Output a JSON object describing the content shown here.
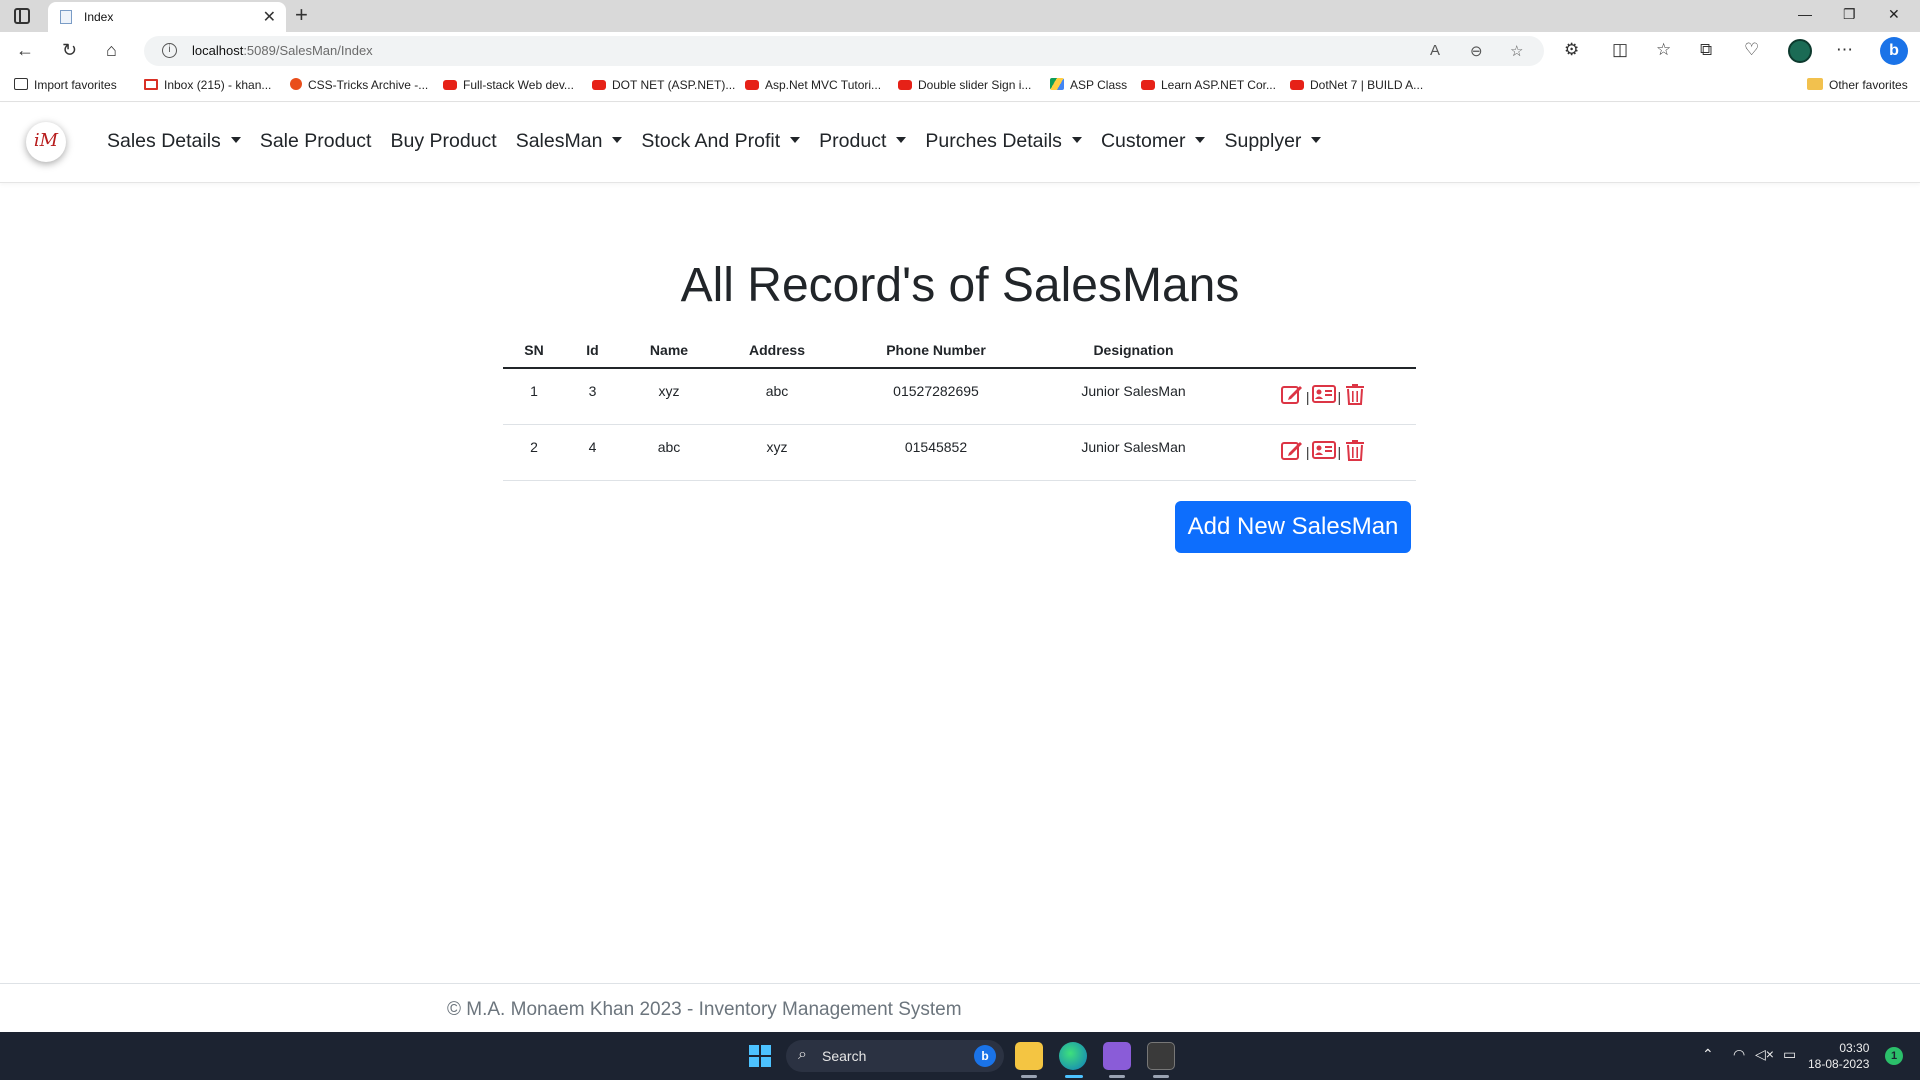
{
  "browser": {
    "tab_title": "Index",
    "tab_close": "✕",
    "new_tab": "+",
    "url_host": "localhost",
    "url_path": ":5089/SalesMan/Index",
    "favorites": [
      {
        "label": "Import favorites",
        "icon": "import-icon"
      },
      {
        "label": "Inbox (215) - khan...",
        "icon": "gmail-icon"
      },
      {
        "label": "CSS-Tricks Archive -...",
        "icon": "css-tricks-icon"
      },
      {
        "label": "Full-stack Web dev...",
        "icon": "youtube-icon"
      },
      {
        "label": "DOT NET (ASP.NET)...",
        "icon": "youtube-icon"
      },
      {
        "label": "Asp.Net MVC Tutori...",
        "icon": "youtube-icon"
      },
      {
        "label": "Double slider Sign i...",
        "icon": "youtube-icon"
      },
      {
        "label": "ASP Class",
        "icon": "drive-icon"
      },
      {
        "label": "Learn ASP.NET Cor...",
        "icon": "youtube-icon"
      },
      {
        "label": "DotNet 7 | BUILD A...",
        "icon": "youtube-icon"
      }
    ],
    "other_favorites": "Other favorites"
  },
  "site": {
    "logo_text": "iM",
    "menu": [
      {
        "label": "Sales Details",
        "dropdown": true
      },
      {
        "label": "Sale Product",
        "dropdown": false
      },
      {
        "label": "Buy Product",
        "dropdown": false
      },
      {
        "label": "SalesMan",
        "dropdown": true
      },
      {
        "label": "Stock And Profit",
        "dropdown": true
      },
      {
        "label": "Product",
        "dropdown": true
      },
      {
        "label": "Purches Details",
        "dropdown": true
      },
      {
        "label": "Customer",
        "dropdown": true
      },
      {
        "label": "Supplyer",
        "dropdown": true
      }
    ]
  },
  "main": {
    "title": "All Record's of SalesMans",
    "table": {
      "headers": [
        "SN",
        "Id",
        "Name",
        "Address",
        "Phone Number",
        "Designation",
        ""
      ],
      "rows": [
        [
          "1",
          "3",
          "xyz",
          "abc",
          "01527282695",
          "Junior SalesMan"
        ],
        [
          "2",
          "4",
          "abc",
          "xyz",
          "01545852",
          "Junior SalesMan"
        ]
      ],
      "separator": "|"
    },
    "add_button": "Add New SalesMan",
    "action_color": "#dc3545"
  },
  "footer": {
    "text": "© M.A. Monaem Khan 2023 - Inventory Management System"
  },
  "taskbar": {
    "search_label": "Search",
    "time": "03:30",
    "date": "18-08-2023",
    "notification_count": "1"
  }
}
